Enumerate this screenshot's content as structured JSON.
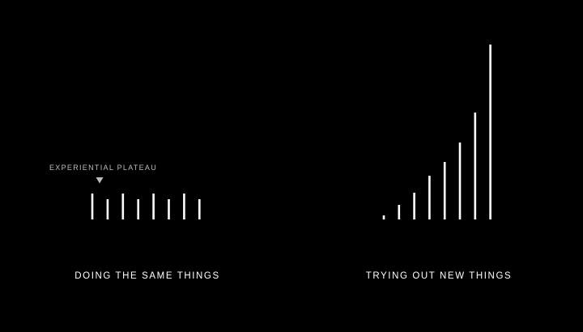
{
  "colors": {
    "background": "#000000",
    "bars": "#ffffff",
    "annotation": "#bdbdbd"
  },
  "chart_data": [
    {
      "type": "bar",
      "title": "DOING THE SAME THINGS",
      "values": [
        32,
        25,
        32,
        25,
        32,
        25,
        32,
        25
      ],
      "ylim": [
        0,
        220
      ],
      "grid": false,
      "annotation": {
        "text": "EXPERIENTIAL PLATEAU",
        "marker": "down-triangle",
        "points_to_index": 0
      }
    },
    {
      "type": "bar",
      "title": "TRYING OUT NEW THINGS",
      "values": [
        5,
        18,
        33,
        54,
        71,
        95,
        132,
        216
      ],
      "ylim": [
        0,
        220
      ],
      "grid": false
    }
  ]
}
